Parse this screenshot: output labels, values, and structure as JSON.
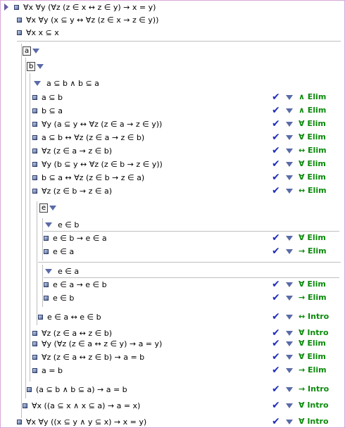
{
  "rows": [
    {
      "text": "∀x ∀y (∀z (z ∈ x ↔ z ∈ y) → x = y)"
    },
    {
      "text": "∀x ∀y (x ⊆ y ↔ ∀z (z ∈ x → z ∈ y))"
    },
    {
      "text": "∀x x ⊆ x"
    },
    {
      "label": "a"
    },
    {
      "label": "b"
    },
    {
      "text": "a ⊆ b ∧ b ⊆ a"
    },
    {
      "text": "a ⊆ b",
      "rule": "∧ Elim"
    },
    {
      "text": "b ⊆ a",
      "rule": "∧ Elim"
    },
    {
      "text": "∀y (a ⊆ y ↔ ∀z (z ∈ a → z ∈ y))",
      "rule": "∀ Elim"
    },
    {
      "text": "a ⊆ b ↔ ∀z (z ∈ a → z ∈ b)",
      "rule": "∀ Elim"
    },
    {
      "text": "∀z (z ∈ a → z ∈ b)",
      "rule": "↔ Elim"
    },
    {
      "text": "∀y (b ⊆ y ↔ ∀z (z ∈ b → z ∈ y))",
      "rule": "∀ Elim"
    },
    {
      "text": "b ⊆ a ↔ ∀z (z ∈ b → z ∈ a)",
      "rule": "∀ Elim"
    },
    {
      "text": "∀z (z ∈ b → z ∈ a)",
      "rule": "↔ Elim"
    },
    {
      "label": "e"
    },
    {
      "text": "e ∈ b"
    },
    {
      "text": "e ∈ b → e ∈ a",
      "rule": "∀ Elim"
    },
    {
      "text": "e ∈ a",
      "rule": "→ Elim"
    },
    {
      "text": "e ∈ a"
    },
    {
      "text": "e ∈ a → e ∈ b",
      "rule": "∀ Elim"
    },
    {
      "text": "e ∈ b",
      "rule": "→ Elim"
    },
    {
      "text": "e ∈ a ↔ e ∈ b",
      "rule": "↔ Intro"
    },
    {
      "text": "∀z (z ∈ a ↔ z ∈ b)",
      "rule": "∀ Intro"
    },
    {
      "text": "∀y (∀z (z ∈ a ↔ z ∈ y) → a = y)",
      "rule": "∀ Elim"
    },
    {
      "text": "∀z (z ∈ a ↔ z ∈ b) → a = b",
      "rule": "∀ Elim"
    },
    {
      "text": "a = b",
      "rule": "→ Elim"
    },
    {
      "text": "(a ⊆ b ∧ b ⊆ a) → a = b",
      "rule": "→ Intro"
    },
    {
      "text": "∀x ((a ⊆ x ∧ x ⊆ a) → a = x)",
      "rule": "∀ Intro"
    },
    {
      "text": "∀x ∀y ((x ⊆ y ∧ y ⊆ x) → x = y)",
      "rule": "∀ Intro"
    }
  ]
}
